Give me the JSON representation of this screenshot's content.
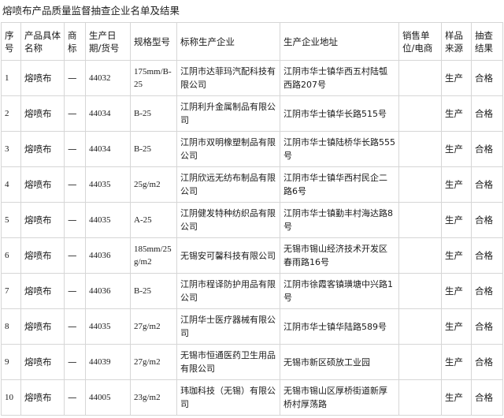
{
  "title": "熔喷布产品质量监督抽查企业名单及结果",
  "table": {
    "headers": [
      "序号",
      "产品具体名称",
      "商标",
      "生产日期/货号",
      "规格型号",
      "标称生产企业",
      "生产企业地址",
      "销售单位/电商",
      "样品来源",
      "抽查结果"
    ],
    "rows": [
      [
        "1",
        "熔喷布",
        "—",
        "44032",
        "175mm/B-25",
        "江阴市达菲玛汽配科技有限公司",
        "江阴市华士镇华西五村陆瓠西路207号",
        "",
        "生产",
        "合格"
      ],
      [
        "2",
        "熔喷布",
        "—",
        "44034",
        "B-25",
        "江阴利升金属制品有限公司",
        "江阴市华士镇华长路515号",
        "",
        "生产",
        "合格"
      ],
      [
        "3",
        "熔喷布",
        "—",
        "44034",
        "B-25",
        "江阴市双明橡塑制品有限公司",
        "江阴市华士镇陆桥华长路555号",
        "",
        "生产",
        "合格"
      ],
      [
        "4",
        "熔喷布",
        "—",
        "44035",
        "25g/m2",
        "江阴欣远无纺布制品有限公司",
        "江阴市华士镇华西村民企二路6号",
        "",
        "生产",
        "合格"
      ],
      [
        "5",
        "熔喷布",
        "—",
        "44035",
        "A-25",
        "江阴健发特种纺织品有限公司",
        "江阴市华士镇勤丰村海达路8号",
        "",
        "生产",
        "合格"
      ],
      [
        "6",
        "熔喷布",
        "—",
        "44036",
        "185mm/25g/m2",
        "无锡安可馨科技有限公司",
        "无锡市锡山经济技术开发区春雨路16号",
        "",
        "生产",
        "合格"
      ],
      [
        "7",
        "熔喷布",
        "—",
        "44036",
        "B-25",
        "江阴市程译防护用品有限公司",
        "江阴市徐霞客镇璜塘中兴路1号",
        "",
        "生产",
        "合格"
      ],
      [
        "8",
        "熔喷布",
        "—",
        "44035",
        "27g/m2",
        "江阴华士医疗器械有限公司",
        "江阴市华士镇华陆路589号",
        "",
        "生产",
        "合格"
      ],
      [
        "9",
        "熔喷布",
        "—",
        "44039",
        "27g/m2",
        "无锡市恒通医药卫生用品有限公司",
        "无锡市新区硕放工业园",
        "",
        "生产",
        "合格"
      ],
      [
        "10",
        "熔喷布",
        "—",
        "44005",
        "23g/m2",
        "玮珈科技（无锡）有限公司",
        "无锡市锡山区厚桥街道新厚桥村厚荡路",
        "",
        "生产",
        "合格"
      ]
    ]
  }
}
